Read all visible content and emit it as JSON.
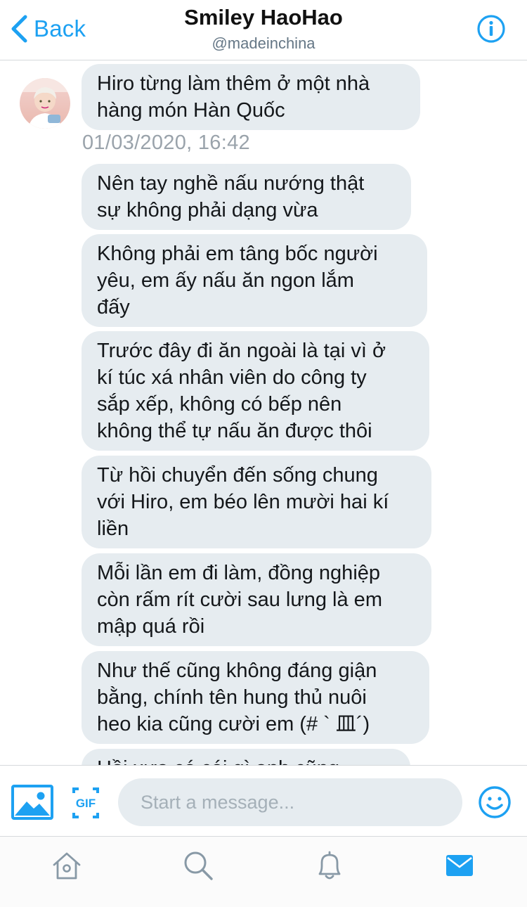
{
  "header": {
    "back_label": "Back",
    "title": "Smiley HaoHao",
    "handle": "@madeinchina",
    "back_icon": "chevron-left-icon",
    "info_icon": "info-icon"
  },
  "conversation": {
    "timestamp": "01/03/2020, 16:42",
    "messages": [
      {
        "text": "Hiro từng làm thêm ở một nhà\nhàng món Hàn Quốc"
      },
      {
        "text": "Nên tay nghề nấu nướng thật\nsự không phải dạng vừa"
      },
      {
        "text": "Không phải em tâng bốc người\nyêu, em ấy nấu ăn ngon lắm\nđấy"
      },
      {
        "text": "Trước đây đi ăn ngoài là tại vì ở\nkí túc xá nhân viên do công ty\nsắp xếp, không có bếp nên\nkhông thể tự nấu ăn được thôi"
      },
      {
        "text": "Từ hồi chuyển đến sống chung\nvới Hiro, em béo lên mười hai kí\nliền"
      },
      {
        "text": "Mỗi lần em đi làm, đồng nghiệp\ncòn rấm rít cười sau lưng là em\nmập quá rồi"
      },
      {
        "text": "Như thế cũng không đáng giận\nbằng, chính tên hung thủ nuôi\nheo kia cũng cười em (# ` 皿´)"
      },
      {
        "text": "Hồi xưa có cái gì anh cũng"
      }
    ]
  },
  "composer": {
    "placeholder": "Start a message...",
    "gif_label": "GIF",
    "image_icon": "image-icon",
    "emoji_icon": "emoji-icon"
  },
  "tabbar": {
    "items": [
      {
        "icon": "home-icon"
      },
      {
        "icon": "search-icon"
      },
      {
        "icon": "bell-icon"
      },
      {
        "icon": "mail-icon",
        "active": true
      }
    ]
  },
  "colors": {
    "accent": "#1da1f2",
    "bubble": "#e6ecf0",
    "muted": "#9aa3ab"
  }
}
